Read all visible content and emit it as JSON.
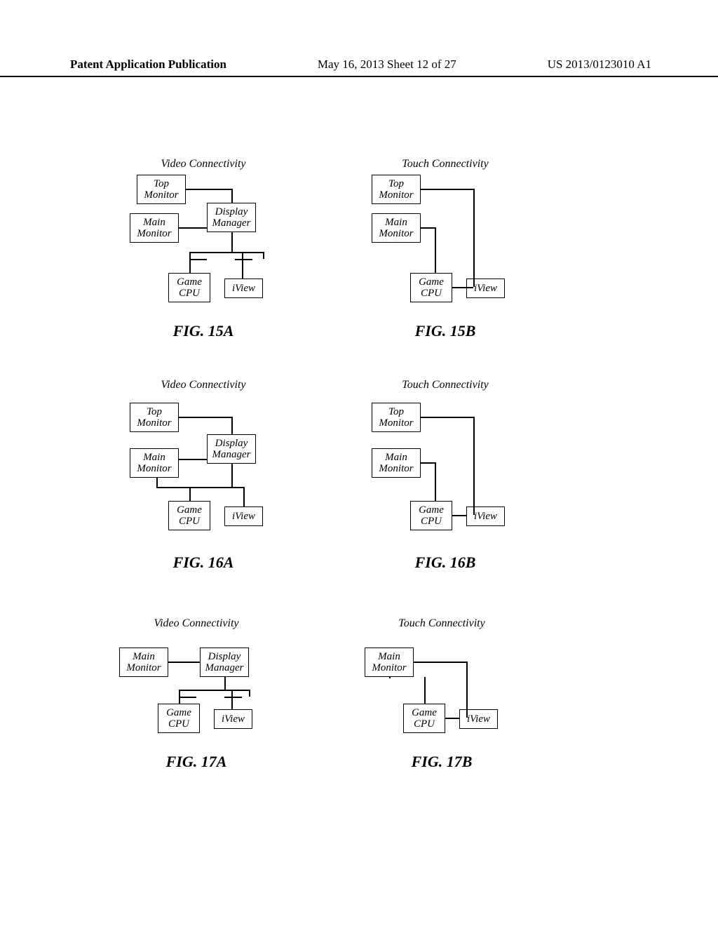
{
  "header": {
    "left": "Patent Application Publication",
    "center": "May 16, 2013  Sheet 12 of 27",
    "right": "US 2013/0123010 A1"
  },
  "labels": {
    "video": "Video Connectivity",
    "touch": "Touch Connectivity",
    "top_monitor": "Top\nMonitor",
    "main_monitor": "Main\nMonitor",
    "display_manager": "Display\nManager",
    "game_cpu": "Game\nCPU",
    "iview": "iView"
  },
  "captions": {
    "f15a": "FIG. 15A",
    "f15b": "FIG. 15B",
    "f16a": "FIG. 16A",
    "f16b": "FIG. 16B",
    "f17a": "FIG. 17A",
    "f17b": "FIG. 17B"
  }
}
